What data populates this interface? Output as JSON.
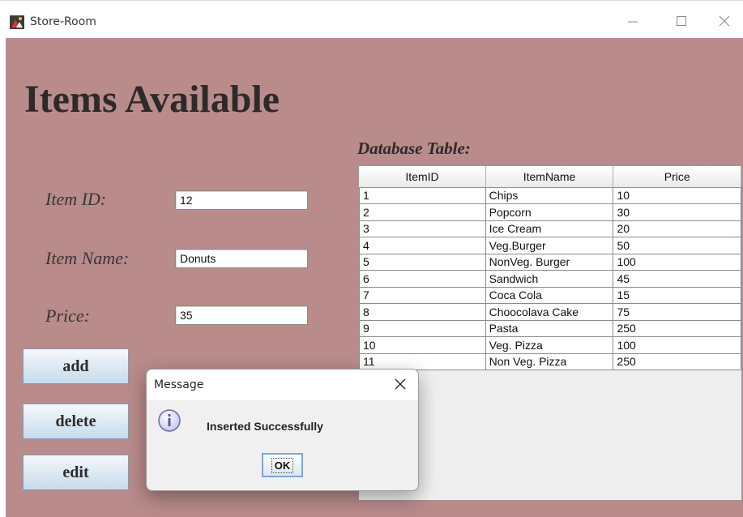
{
  "window": {
    "title": "Store-Room",
    "minimize_icon": "minimize-icon",
    "maximize_icon": "maximize-icon",
    "close_icon": "close-icon"
  },
  "colors": {
    "background": "#b98b8b",
    "button_gradient_top": "#f4f8fc",
    "button_gradient_bottom": "#c7dbeb",
    "dialog_background": "#f0f0f0"
  },
  "form": {
    "heading": "Items Available",
    "item_id_label": "Item ID:",
    "item_id_value": "12",
    "item_name_label": "Item Name:",
    "item_name_value": "Donuts",
    "price_label": "Price:",
    "price_value": "35"
  },
  "buttons": {
    "add": "add",
    "delete": "delete",
    "edit": "edit"
  },
  "table": {
    "caption": "Database Table:",
    "columns": [
      "ItemID",
      "ItemName",
      "Price"
    ],
    "rows": [
      [
        "1",
        "Chips",
        "10"
      ],
      [
        "2",
        "Popcorn",
        "30"
      ],
      [
        "3",
        "Ice Cream",
        "20"
      ],
      [
        "4",
        "Veg.Burger",
        "50"
      ],
      [
        "5",
        "NonVeg. Burger",
        "100"
      ],
      [
        "6",
        "Sandwich",
        "45"
      ],
      [
        "7",
        "Coca Cola",
        "15"
      ],
      [
        "8",
        "Choocolava Cake",
        "75"
      ],
      [
        "9",
        "Pasta",
        "250"
      ],
      [
        "10",
        "Veg. Pizza",
        "100"
      ],
      [
        "11",
        "Non Veg. Pizza",
        "250"
      ]
    ]
  },
  "dialog": {
    "title": "Message",
    "message": "Inserted Successfully",
    "ok_label": "OK",
    "icon": "info-icon"
  }
}
